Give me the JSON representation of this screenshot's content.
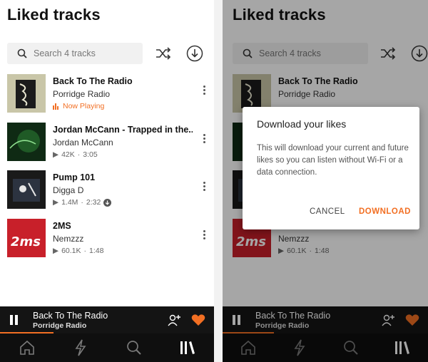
{
  "screens": [
    {
      "title": "Liked tracks",
      "search": {
        "placeholder": "Search 4 tracks"
      }
    },
    {
      "title": "Liked tracks",
      "search": {
        "placeholder": "Search 4 tracks"
      }
    }
  ],
  "tracks": [
    {
      "title": "Back To The Radio",
      "artist": "Porridge Radio",
      "status": "Now Playing"
    },
    {
      "title": "Jordan McCann - Trapped in the...",
      "artist": "Jordan McCann",
      "plays": "42K",
      "duration": "3:05"
    },
    {
      "title": "Pump 101",
      "artist": "Digga D",
      "plays": "1.4M",
      "duration": "2:32",
      "downloaded": true
    },
    {
      "title": "2MS",
      "artist": "Nemzzz",
      "plays": "60.1K",
      "duration": "1:48"
    }
  ],
  "mini_player": {
    "title": "Back To The Radio",
    "artist": "Porridge Radio",
    "progress": 0.25
  },
  "dialog": {
    "title": "Download your likes",
    "body": "This will download your current and future likes so you can listen without Wi-Fi or a data connection.",
    "cancel_label": "CANCEL",
    "confirm_label": "DOWNLOAD"
  },
  "nav": [
    "home-icon",
    "lightning-icon",
    "search-icon",
    "library-icon"
  ],
  "colors": {
    "accent": "#f26f23",
    "player_bg": "#141414",
    "nav_bg": "#0f0f0f"
  }
}
